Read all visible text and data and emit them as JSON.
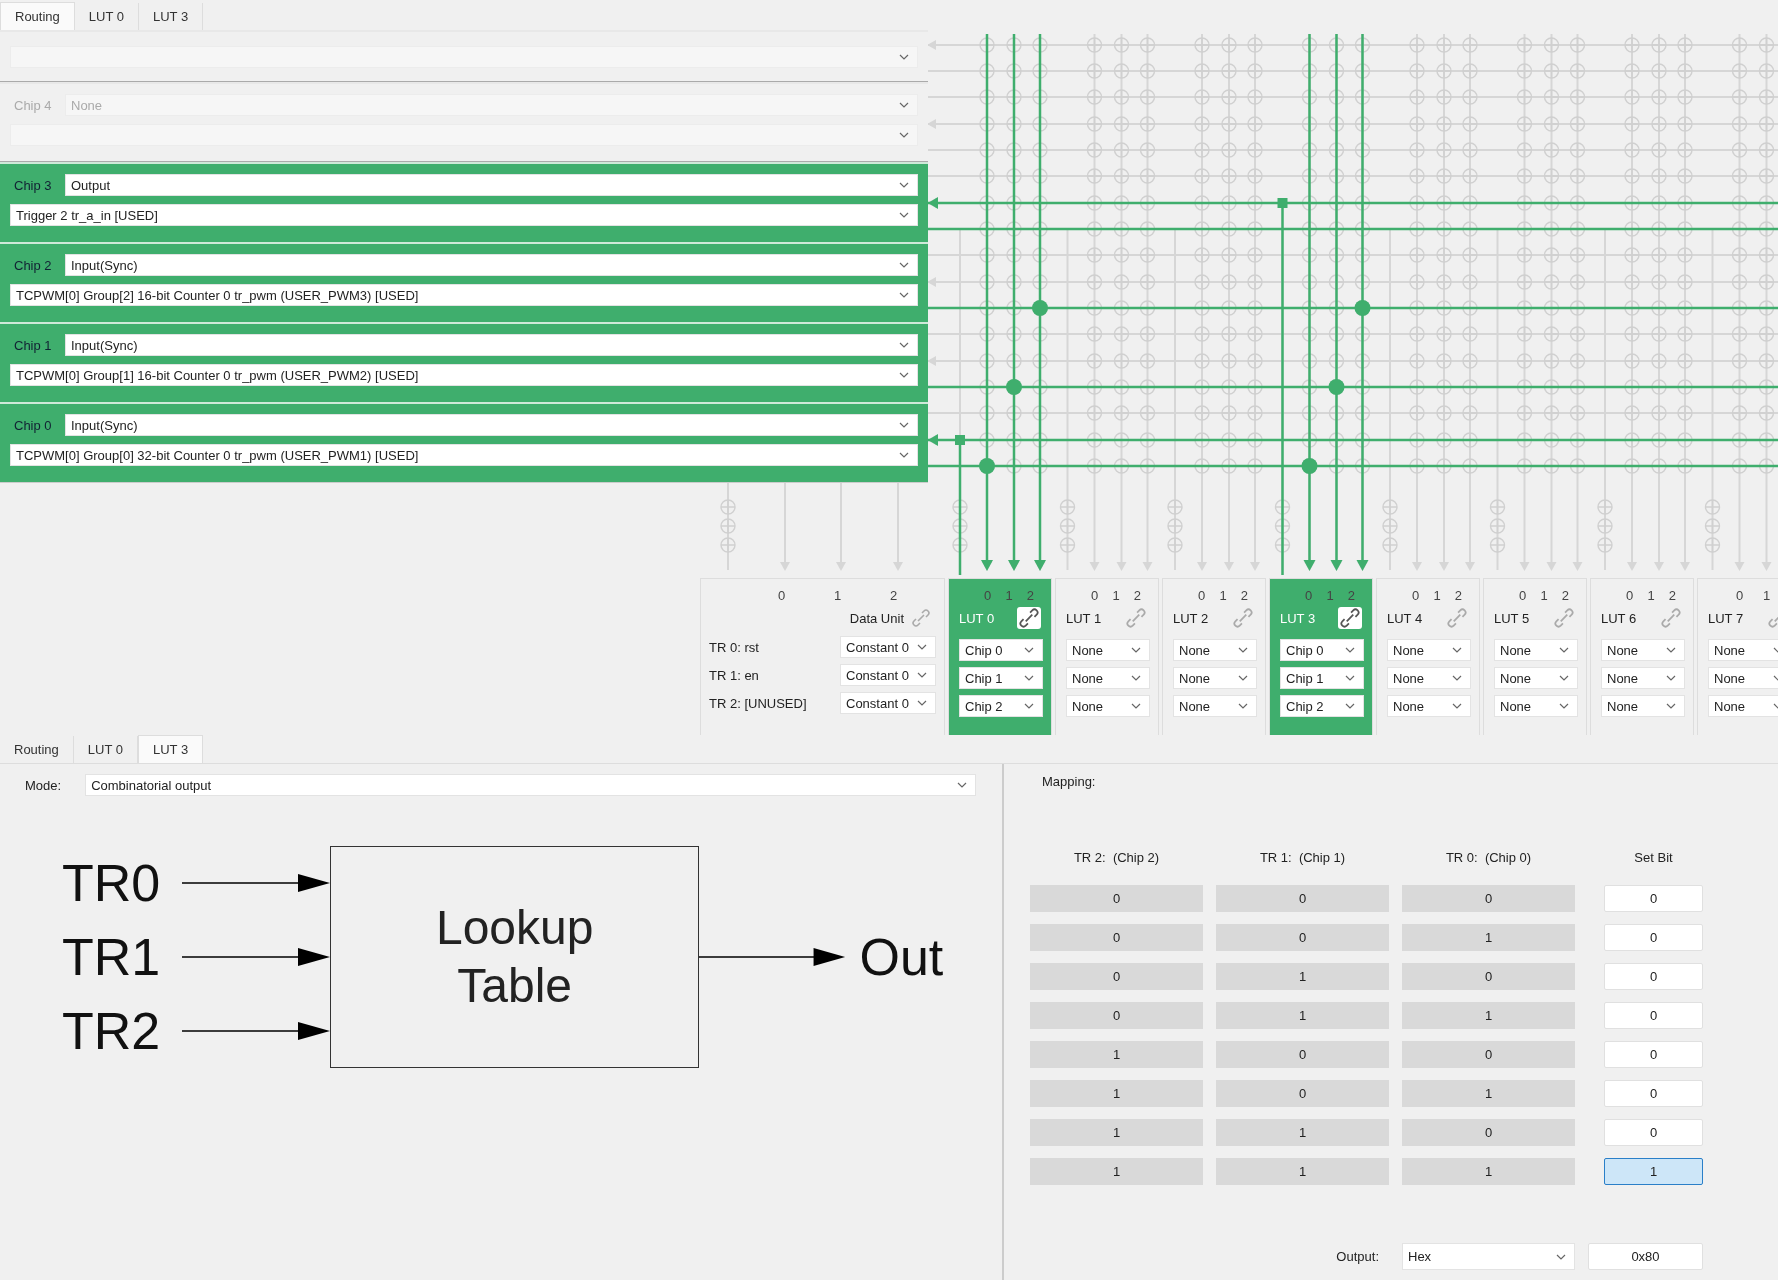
{
  "top_tabs": [
    {
      "label": "Routing",
      "selected": true
    },
    {
      "label": "LUT 0",
      "selected": false
    },
    {
      "label": "LUT 3",
      "selected": false
    }
  ],
  "chips": [
    {
      "active": false
    },
    {
      "label": "Chip 4",
      "mode": "None",
      "active": false
    },
    {
      "label": "Chip 3",
      "mode": "Output",
      "signal": "Trigger 2 tr_a_in [USED]",
      "active": true
    },
    {
      "label": "Chip 2",
      "mode": "Input(Sync)",
      "signal": "TCPWM[0] Group[2] 16-bit Counter 0 tr_pwm (USER_PWM3) [USED]",
      "active": true
    },
    {
      "label": "Chip 1",
      "mode": "Input(Sync)",
      "signal": "TCPWM[0] Group[1] 16-bit Counter 0 tr_pwm (USER_PWM2) [USED]",
      "active": true
    },
    {
      "label": "Chip 0",
      "mode": "Input(Sync)",
      "signal": "TCPWM[0] Group[0] 32-bit Counter 0 tr_pwm (USER_PWM1) [USED]",
      "active": true
    }
  ],
  "data_unit": {
    "columns": [
      "0",
      "1",
      "2"
    ],
    "title": "Data Unit",
    "rows": [
      {
        "label": "TR 0: rst",
        "value": "Constant 0"
      },
      {
        "label": "TR 1: en",
        "value": "Constant 0"
      },
      {
        "label": "TR 2: [UNUSED]",
        "value": "Constant 0"
      }
    ]
  },
  "luts": [
    {
      "columns": [
        "0",
        "1",
        "2"
      ],
      "title": "LUT 0",
      "selected": true,
      "inputs": [
        "Chip 0",
        "Chip 1",
        "Chip 2"
      ]
    },
    {
      "columns": [
        "0",
        "1",
        "2"
      ],
      "title": "LUT 1",
      "selected": false,
      "inputs": [
        "None",
        "None",
        "None"
      ]
    },
    {
      "columns": [
        "0",
        "1",
        "2"
      ],
      "title": "LUT 2",
      "selected": false,
      "inputs": [
        "None",
        "None",
        "None"
      ]
    },
    {
      "columns": [
        "0",
        "1",
        "2"
      ],
      "title": "LUT 3",
      "selected": true,
      "inputs": [
        "Chip 0",
        "Chip 1",
        "Chip 2"
      ]
    },
    {
      "columns": [
        "0",
        "1",
        "2"
      ],
      "title": "LUT 4",
      "selected": false,
      "inputs": [
        "None",
        "None",
        "None"
      ]
    },
    {
      "columns": [
        "0",
        "1",
        "2"
      ],
      "title": "LUT 5",
      "selected": false,
      "inputs": [
        "None",
        "None",
        "None"
      ]
    },
    {
      "columns": [
        "0",
        "1",
        "2"
      ],
      "title": "LUT 6",
      "selected": false,
      "inputs": [
        "None",
        "None",
        "None"
      ]
    },
    {
      "columns": [
        "0",
        "1"
      ],
      "title": "LUT 7",
      "selected": false,
      "inputs": [
        "None",
        "None",
        "None"
      ]
    }
  ],
  "bottom_tabs": [
    {
      "label": "Routing",
      "selected": false
    },
    {
      "label": "LUT 0",
      "selected": false
    },
    {
      "label": "LUT 3",
      "selected": true
    }
  ],
  "mode": {
    "label": "Mode:",
    "value": "Combinatorial output"
  },
  "diagram": {
    "inputs": [
      "TR0",
      "TR1",
      "TR2"
    ],
    "block": "Lookup Table",
    "output": "Out"
  },
  "mapping": {
    "title": "Mapping:",
    "columns": [
      "TR 2:  (Chip 2)",
      "TR 1:  (Chip 1)",
      "TR 0:  (Chip 0)",
      "Set Bit"
    ],
    "rows": [
      {
        "cells": [
          "0",
          "0",
          "0"
        ],
        "bit": "0",
        "selected": false
      },
      {
        "cells": [
          "0",
          "0",
          "1"
        ],
        "bit": "0",
        "selected": false
      },
      {
        "cells": [
          "0",
          "1",
          "0"
        ],
        "bit": "0",
        "selected": false
      },
      {
        "cells": [
          "0",
          "1",
          "1"
        ],
        "bit": "0",
        "selected": false
      },
      {
        "cells": [
          "1",
          "0",
          "0"
        ],
        "bit": "0",
        "selected": false
      },
      {
        "cells": [
          "1",
          "0",
          "1"
        ],
        "bit": "0",
        "selected": false
      },
      {
        "cells": [
          "1",
          "1",
          "0"
        ],
        "bit": "0",
        "selected": false
      },
      {
        "cells": [
          "1",
          "1",
          "1"
        ],
        "bit": "1",
        "selected": true
      }
    ],
    "output": {
      "label": "Output:",
      "format": "Hex",
      "value": "0x80"
    }
  }
}
